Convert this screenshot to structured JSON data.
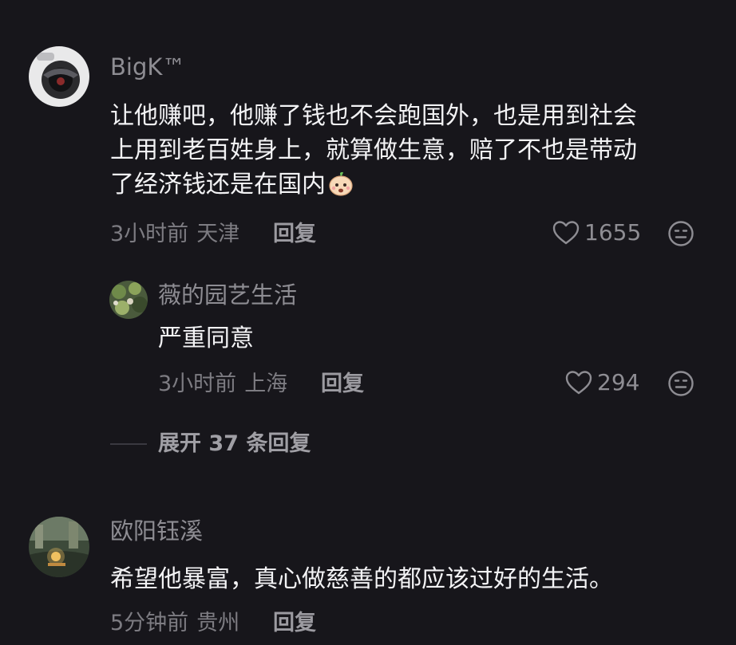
{
  "comments": [
    {
      "username": "BigK™",
      "text_lines": [
        "让他赚吧，他赚了钱也不会跑国外，也是用到社会",
        "上用到老百姓身上，就算做生意，赔了不也是带动",
        "了经济钱还是在国内"
      ],
      "emoji_icon": "peach-face-emoji",
      "time": "3小时前",
      "location": "天津",
      "reply_label": "回复",
      "likes": "1655",
      "reply": {
        "username": "薇的园艺生活",
        "text": "严重同意",
        "time": "3小时前",
        "location": "上海",
        "reply_label": "回复",
        "likes": "294"
      },
      "expand_label": "展开 37 条回复"
    },
    {
      "username": "欧阳钰溪",
      "text": "希望他暴富，真心做慈善的都应该过好的生活。",
      "time": "5分钟前",
      "location": "贵州",
      "reply_label": "回复"
    }
  ],
  "icons": {
    "like": "heart-outline-icon",
    "dislike": "neutral-face-icon"
  },
  "colors": {
    "background": "#17161b",
    "primary_text": "#f3f3f5",
    "secondary_text": "#8e8d93"
  }
}
